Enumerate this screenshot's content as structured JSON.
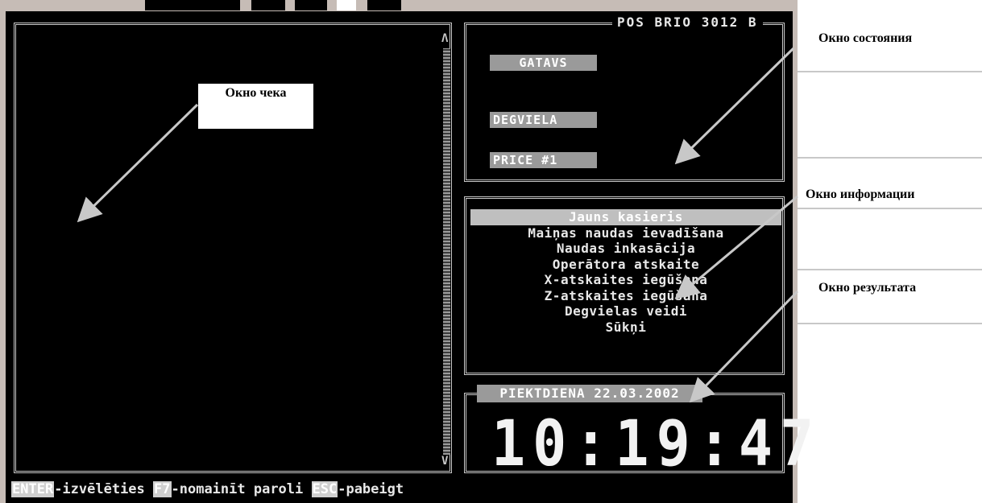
{
  "device_title": "POS BRIO 3012 B",
  "status_window": {
    "ready": "GATAVS",
    "fuel": "DEGVIELA",
    "price": "PRICE #1"
  },
  "menu": {
    "items": [
      {
        "label": "Jauns kasieris",
        "selected": true
      },
      {
        "label": "Maiņas naudas ievadīšana",
        "selected": false
      },
      {
        "label": "Naudas inkasācija",
        "selected": false
      },
      {
        "label": "Operātora atskaite",
        "selected": false
      },
      {
        "label": "X-atskaites iegūšana",
        "selected": false
      },
      {
        "label": "Z-atskaites iegūšana",
        "selected": false
      },
      {
        "label": "Degvielas veidi",
        "selected": false
      },
      {
        "label": "Sūkņi",
        "selected": false
      }
    ]
  },
  "result_window": {
    "date": "PIEKTDIENA 22.03.2002",
    "time": "10:19:47"
  },
  "hotkeys": {
    "enter_key": "ENTER",
    "enter_text": "-izvēlēties ",
    "f7_key": "F7",
    "f7_text": "-nomainīt paroli ",
    "esc_key": "ESC",
    "esc_text": "-pabeigt"
  },
  "callouts": {
    "receipt": "Окно чека",
    "status": "Окно состояния",
    "info": "Окно информации",
    "result": "Окно результата"
  },
  "colors": {
    "screen_bg": "#000000",
    "frame": "#c8c8c8",
    "label_bg": "#9a9a9a",
    "bezel": "#c6bcb6"
  }
}
